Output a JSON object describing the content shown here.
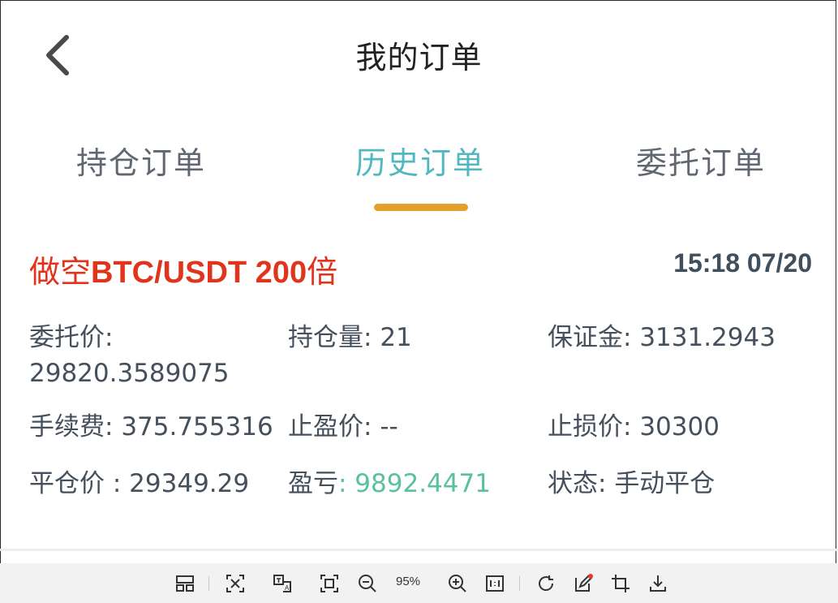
{
  "header": {
    "title": "我的订单",
    "back_icon": "chevron-left-icon"
  },
  "tabs": [
    {
      "label": "持仓订单",
      "active": false
    },
    {
      "label": "历史订单",
      "active": true
    },
    {
      "label": "委托订单",
      "active": false
    }
  ],
  "order": {
    "direction": "做空",
    "pair": "BTC/USDT 200",
    "leverage_suffix": "倍",
    "time": "15:18 07/20",
    "fields": {
      "entrust_price_label": "委托价:",
      "entrust_price_value": "29820.3589075",
      "position_label": "持仓量:",
      "position_value": "21",
      "margin_label": "保证金:",
      "margin_value": "3131.2943",
      "fee_label": "手续费:",
      "fee_value": "375.755316",
      "take_profit_label": "止盈价:",
      "take_profit_value": "--",
      "stop_loss_label": "止损价:",
      "stop_loss_value": "30300",
      "close_price_label": "平仓价 :",
      "close_price_value": "29349.29",
      "pnl_label": "盈亏",
      "pnl_value": ": 9892.4471",
      "status_label": "状态:",
      "status_value": "手动平仓"
    },
    "colors": {
      "direction": "#e0341c",
      "pnl": "#5ac0a2",
      "active_tab": "#52b7bf",
      "indicator": "#e4a02c"
    }
  },
  "viewer_toolbar": {
    "zoom": "95%",
    "icons": [
      "layout-icon",
      "fit-width-icon",
      "translate-icon",
      "fit-page-icon",
      "zoom-out-icon",
      "zoom-in-icon",
      "actual-size-icon",
      "rotate-icon",
      "edit-icon",
      "crop-icon",
      "download-icon"
    ]
  }
}
